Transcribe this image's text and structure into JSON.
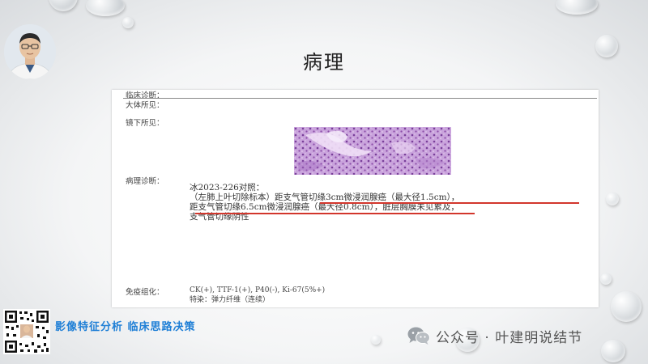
{
  "slide": {
    "title": "病理",
    "slogan": "影像特征分析  临床思路决策"
  },
  "report": {
    "clinical_diagnosis_label": "临床诊断：",
    "gross_label": "大体所见：",
    "microscopic_label": "镜下所见：",
    "pathology_label": "病理诊断：",
    "diagnosis_lines": [
      "冰2023-226对照：",
      "（左肺上叶切除标本）距支气管切缘3cm微浸润腺癌（最大径1.5cm），",
      "距支气管切缘6.5cm微浸润腺癌（最大径0.8cm），脏层胸膜未见累及，",
      "支气管切缘阴性"
    ],
    "ihc_label": "免疫组化：",
    "ihc_lines": [
      "CK(+), TTF-1(+), P40(-), Ki-67(5%+)",
      "特染：弹力纤维（连续）"
    ]
  },
  "watermark": {
    "text": "公众号 · 叶建明说结节",
    "icon": "wechat-icon"
  },
  "colors": {
    "underline": "#d2362c",
    "slogan": "#1f7fd6",
    "stain": "#c49ad8"
  }
}
